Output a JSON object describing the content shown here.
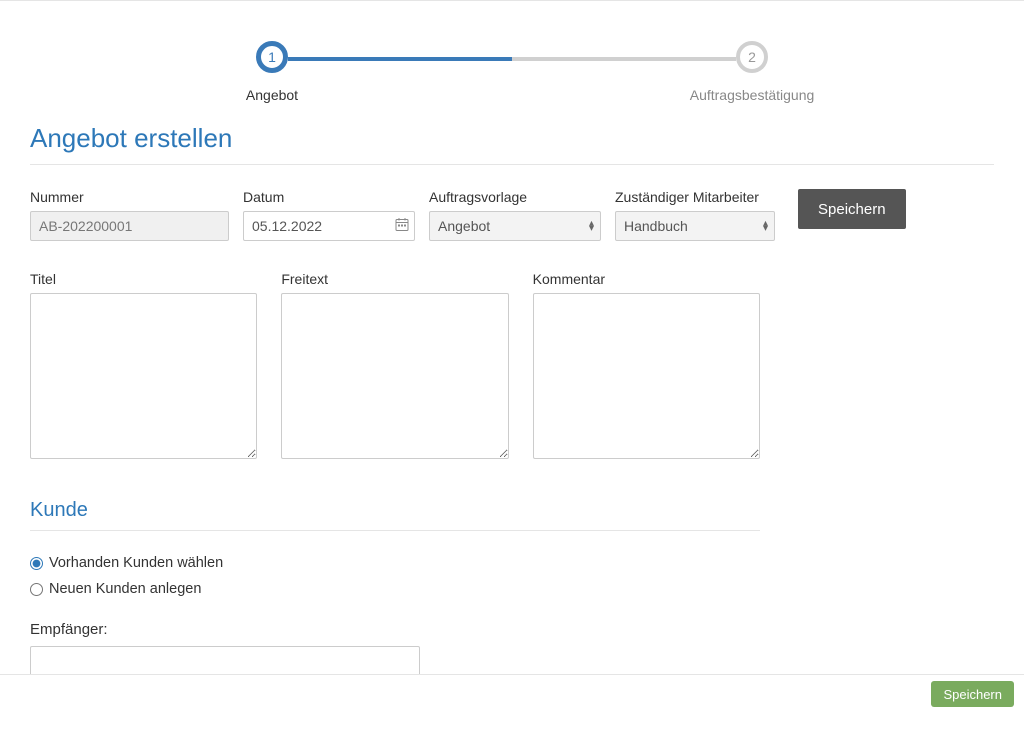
{
  "stepper": {
    "step1_num": "1",
    "step1_label": "Angebot",
    "step2_num": "2",
    "step2_label": "Auftragsbestätigung"
  },
  "page_title": "Angebot erstellen",
  "fields": {
    "nummer_label": "Nummer",
    "nummer_value": "AB-202200001",
    "datum_label": "Datum",
    "datum_value": "05.12.2022",
    "vorlage_label": "Auftragsvorlage",
    "vorlage_value": "Angebot",
    "mitarbeiter_label": "Zuständiger Mitarbeiter",
    "mitarbeiter_value": "Handbuch"
  },
  "buttons": {
    "save_top": "Speichern",
    "save_bottom": "Speichern"
  },
  "textareas": {
    "titel_label": "Titel",
    "titel_value": "",
    "freitext_label": "Freitext",
    "freitext_value": "",
    "kommentar_label": "Kommentar",
    "kommentar_value": ""
  },
  "kunde": {
    "title": "Kunde",
    "radio_existing": "Vorhanden Kunden wählen",
    "radio_new": "Neuen Kunden anlegen",
    "recipient_label": "Empfänger:",
    "recipient_value": ""
  }
}
